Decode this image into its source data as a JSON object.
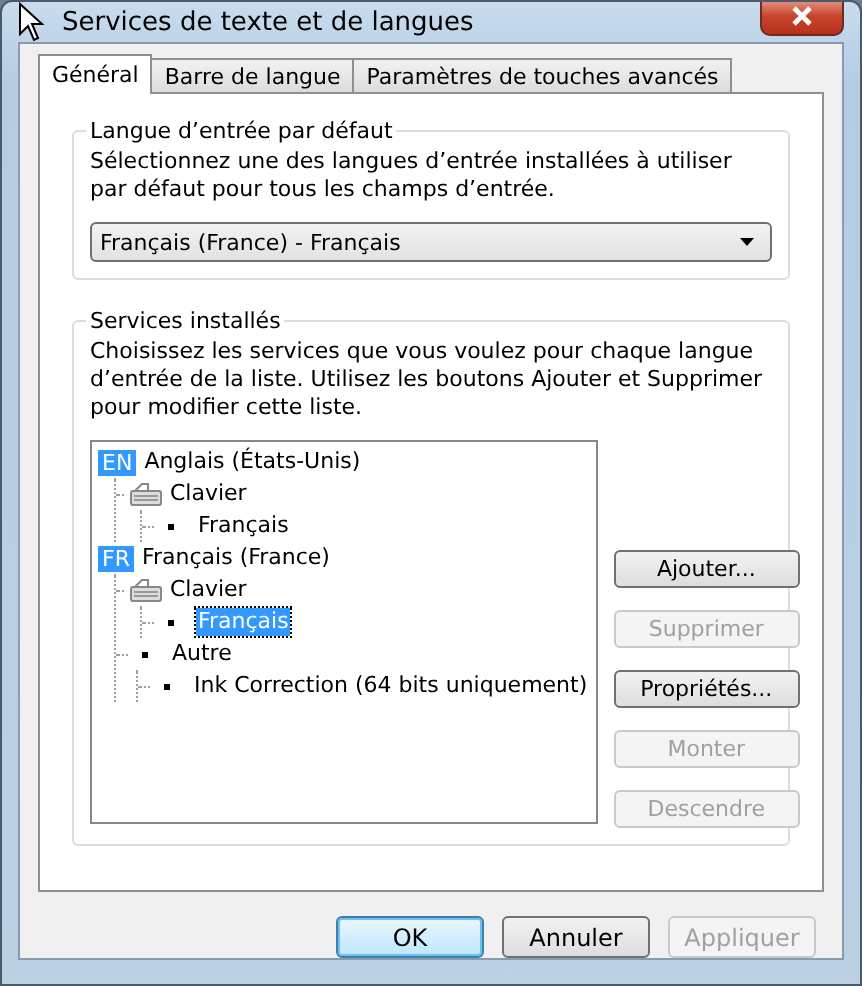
{
  "window": {
    "title": "Services de texte et de langues"
  },
  "tabs": [
    {
      "label": "Général",
      "selected": true
    },
    {
      "label": "Barre de langue",
      "selected": false
    },
    {
      "label": "Paramètres de touches avancés",
      "selected": false
    }
  ],
  "default_language": {
    "legend": "Langue d’entrée par défaut",
    "description": "Sélectionnez une des langues d’entrée installées à utiliser par défaut pour tous les champs d’entrée.",
    "value": "Français (France) - Français"
  },
  "installed_services": {
    "legend": "Services installés",
    "description": "Choisissez les services que vous voulez pour chaque langue d’entrée de la liste. Utilisez les boutons Ajouter et Supprimer pour modifier cette liste.",
    "tree": [
      {
        "kind": "language",
        "badge": "EN",
        "label": "Anglais (États-Unis)",
        "selected": false,
        "children": [
          {
            "kind": "keyboard",
            "label": "Clavier",
            "selected": false,
            "children": [
              {
                "kind": "bullet",
                "label": "Français",
                "selected": false
              }
            ]
          }
        ]
      },
      {
        "kind": "language",
        "badge": "FR",
        "label": "Français (France)",
        "selected": false,
        "children": [
          {
            "kind": "keyboard",
            "label": "Clavier",
            "selected": false,
            "children": [
              {
                "kind": "bullet",
                "label": "Français",
                "selected": true
              }
            ]
          },
          {
            "kind": "bullet",
            "label": "Autre",
            "selected": false,
            "children": [
              {
                "kind": "bullet",
                "label": "Ink Correction (64 bits uniquement)",
                "selected": false
              }
            ]
          }
        ]
      }
    ],
    "buttons": [
      {
        "label": "Ajouter...",
        "disabled": false
      },
      {
        "label": "Supprimer",
        "disabled": true
      },
      {
        "label": "Propriétés...",
        "disabled": false
      },
      {
        "label": "Monter",
        "disabled": true
      },
      {
        "label": "Descendre",
        "disabled": true
      }
    ]
  },
  "dialog_buttons": [
    {
      "label": "OK",
      "default": true,
      "disabled": false
    },
    {
      "label": "Annuler",
      "default": false,
      "disabled": false
    },
    {
      "label": "Appliquer",
      "default": false,
      "disabled": true
    }
  ]
}
